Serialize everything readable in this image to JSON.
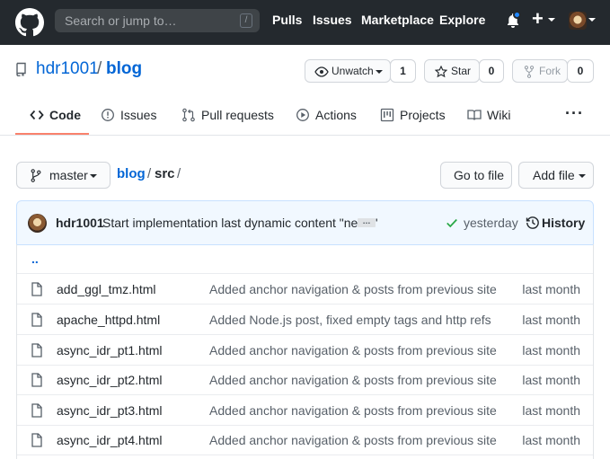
{
  "header": {
    "search_placeholder": "Search or jump to…",
    "search_key": "/",
    "nav": [
      "Pulls",
      "Issues",
      "Marketplace",
      "Explore"
    ],
    "plus": "+"
  },
  "repo": {
    "owner": "hdr1001",
    "separator": "/",
    "name": "blog",
    "watch": {
      "label": "Unwatch",
      "count": "1"
    },
    "star": {
      "label": "Star",
      "count": "0"
    },
    "fork": {
      "label": "Fork",
      "count": "0"
    }
  },
  "tabs": [
    {
      "label": "Code",
      "icon": "code-icon"
    },
    {
      "label": "Issues",
      "icon": "issue-icon"
    },
    {
      "label": "Pull requests",
      "icon": "pull-request-icon"
    },
    {
      "label": "Actions",
      "icon": "play-icon"
    },
    {
      "label": "Projects",
      "icon": "project-icon"
    },
    {
      "label": "Wiki",
      "icon": "book-icon"
    }
  ],
  "more": "···",
  "file_nav": {
    "branch": "master",
    "path": {
      "repo": "blog",
      "sep1": "/",
      "dir": "src",
      "sep2": "/"
    },
    "go_to_file": "Go to file",
    "add_file": "Add file"
  },
  "commit": {
    "author": "hdr1001",
    "message": "Start implementation last dynamic content \"news\"",
    "ellipsis": "…",
    "time": "yesterday",
    "history": "History"
  },
  "files": {
    "parent": "..",
    "rows": [
      {
        "name": "add_ggl_tmz.html",
        "message": "Added anchor navigation & posts from previous site",
        "age": "last month"
      },
      {
        "name": "apache_httpd.html",
        "message": "Added Node.js post, fixed empty tags and http refs",
        "age": "last month"
      },
      {
        "name": "async_idr_pt1.html",
        "message": "Added anchor navigation & posts from previous site",
        "age": "last month"
      },
      {
        "name": "async_idr_pt2.html",
        "message": "Added anchor navigation & posts from previous site",
        "age": "last month"
      },
      {
        "name": "async_idr_pt3.html",
        "message": "Added anchor navigation & posts from previous site",
        "age": "last month"
      },
      {
        "name": "async_idr_pt4.html",
        "message": "Added anchor navigation & posts from previous site",
        "age": "last month"
      }
    ]
  },
  "colors": {
    "header_bg": "#24292e",
    "link": "#0366d6",
    "tab_accent": "#f9826c",
    "commit_bg": "#f1f8ff",
    "success": "#28a745"
  }
}
